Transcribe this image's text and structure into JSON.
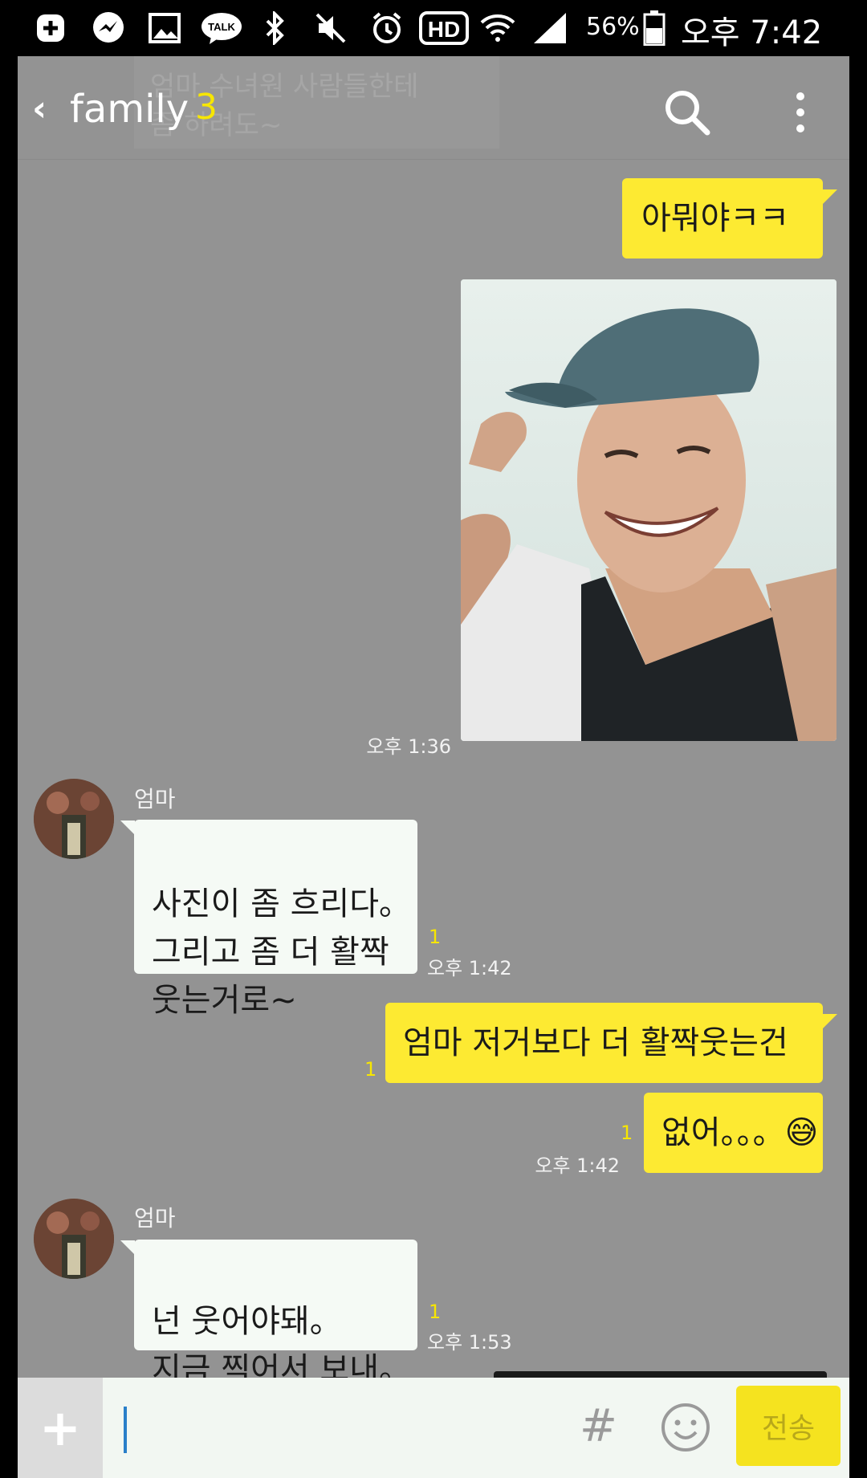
{
  "status_bar": {
    "battery": "56%",
    "time": "오후 7:42",
    "talk_label": "TALK",
    "hd_label": "HD"
  },
  "header": {
    "title": "family",
    "member_count": "3",
    "ghost_text": "엄마 수녀원 사람들한테\n좀 하려도~"
  },
  "messages": {
    "m1": {
      "text": "아뭐야ㅋㅋ"
    },
    "photo": {
      "time": "오후 1:36"
    },
    "m2": {
      "sender": "엄마",
      "text": "사진이 좀 흐리다。\n그리고 좀 더 활짝\n웃는거로~",
      "unread": "1",
      "time": "오후 1:42"
    },
    "m3": {
      "text": "엄마 저거보다 더 활짝웃는건",
      "unread": "1"
    },
    "m4": {
      "text": "없어。。。😅",
      "unread": "1",
      "time": "오후 1:42"
    },
    "m5": {
      "sender": "엄마",
      "text": "넌 웃어야돼。\n지금 찍어서 보내。",
      "unread": "1",
      "time": "오후 1:53"
    }
  },
  "input": {
    "plus": "+",
    "hash": "#",
    "send_label": "전송"
  }
}
